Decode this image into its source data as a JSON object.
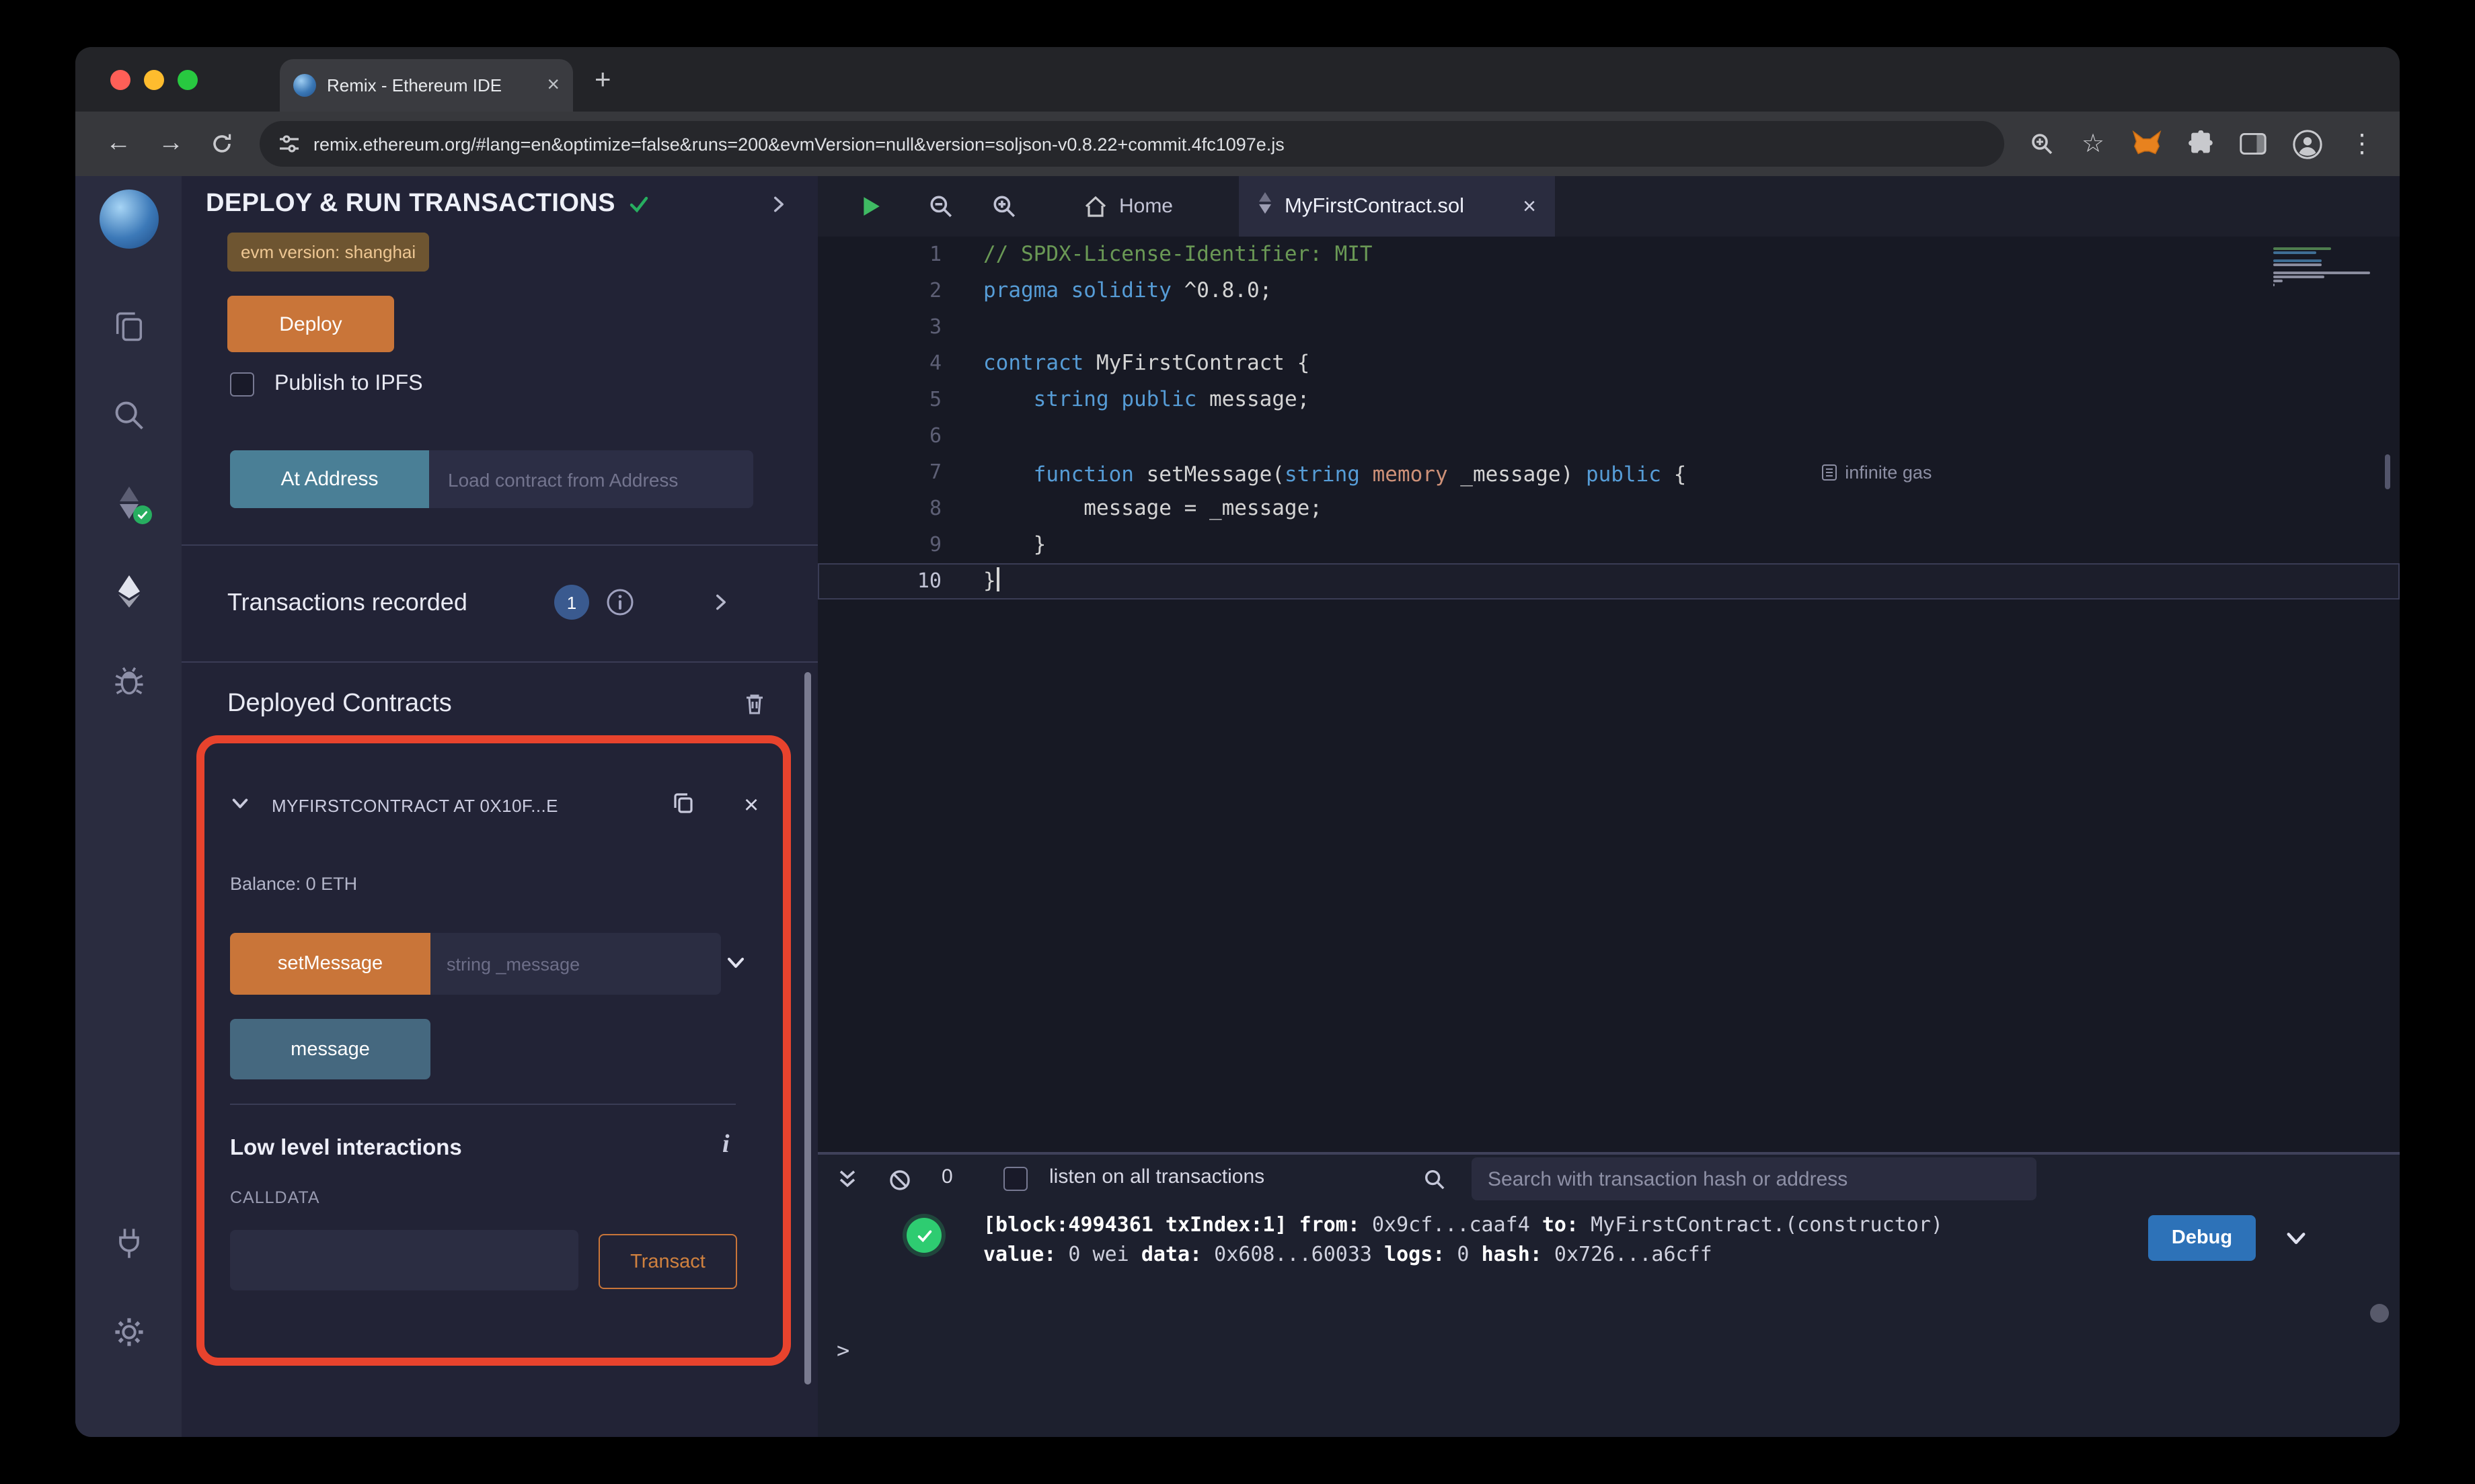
{
  "colors": {
    "accent_orange": "#c97539",
    "steel_blue": "#45687f",
    "at_address_teal": "#4a7f96",
    "debug_blue": "#2d72b8",
    "annotation_red": "#e8432d",
    "success_green": "#27ae60",
    "traffic_lights": [
      "#ff5f57",
      "#febc2e",
      "#28c840"
    ]
  },
  "glyphs": {
    "back": "←",
    "forward": "→",
    "star": "☆",
    "kebab": "⋮",
    "new_tab": "+",
    "tab_close": "×",
    "card_close": "×",
    "low_level_info": "i"
  },
  "browser": {
    "tab_title": "Remix - Ethereum IDE",
    "url": "remix.ethereum.org/#lang=en&optimize=false&runs=200&evmVersion=null&version=soljson-v0.8.22+commit.4fc1097e.js"
  },
  "deploy_panel": {
    "title": "DEPLOY & RUN TRANSACTIONS",
    "evm_badge": "evm version: shanghai",
    "deploy_label": "Deploy",
    "publish_label": "Publish to IPFS",
    "at_address_label": "At Address",
    "at_address_placeholder": "Load contract from Address",
    "transactions_recorded_label": "Transactions recorded",
    "transactions_count": "1",
    "deployed_contracts_label": "Deployed Contracts",
    "contract": {
      "title": "MYFIRSTCONTRACT AT 0X10F...E",
      "balance": "Balance: 0 ETH",
      "set_message_label": "setMessage",
      "set_message_placeholder": "string _message",
      "message_label": "message",
      "low_level_label": "Low level interactions",
      "calldata_label": "CALLDATA",
      "transact_label": "Transact"
    }
  },
  "editor": {
    "home_tab": "Home",
    "active_tab": "MyFirstContract.sol",
    "gas_hint": "infinite gas",
    "code_lines": [
      {
        "n": "1",
        "seg": [
          {
            "t": "// SPDX-License-Identifier: MIT",
            "c": "com"
          }
        ]
      },
      {
        "n": "2",
        "seg": [
          {
            "t": "pragma solidity",
            "c": "kw"
          },
          {
            "t": " ^0.8.0;",
            "c": "pl"
          }
        ]
      },
      {
        "n": "3",
        "seg": []
      },
      {
        "n": "4",
        "seg": [
          {
            "t": "contract",
            "c": "kw"
          },
          {
            "t": " MyFirstContract {",
            "c": "pl"
          }
        ]
      },
      {
        "n": "5",
        "seg": [
          {
            "t": "    ",
            "c": "pl"
          },
          {
            "t": "string",
            "c": "kw"
          },
          {
            "t": " ",
            "c": "pl"
          },
          {
            "t": "public",
            "c": "kw"
          },
          {
            "t": " message;",
            "c": "pl"
          }
        ]
      },
      {
        "n": "6",
        "seg": []
      },
      {
        "n": "7",
        "seg": [
          {
            "t": "    ",
            "c": "pl"
          },
          {
            "t": "function",
            "c": "kw"
          },
          {
            "t": " setMessage(",
            "c": "pl"
          },
          {
            "t": "string",
            "c": "kw"
          },
          {
            "t": " ",
            "c": "pl"
          },
          {
            "t": "memory",
            "c": "str"
          },
          {
            "t": " _message) ",
            "c": "pl"
          },
          {
            "t": "public",
            "c": "kw"
          },
          {
            "t": " {",
            "c": "pl"
          }
        ],
        "gas": true
      },
      {
        "n": "8",
        "seg": [
          {
            "t": "        message = _message;",
            "c": "pl"
          }
        ]
      },
      {
        "n": "9",
        "seg": [
          {
            "t": "    }",
            "c": "pl"
          }
        ]
      },
      {
        "n": "10",
        "seg": [
          {
            "t": "}",
            "c": "pl"
          }
        ],
        "current": true
      }
    ]
  },
  "terminal": {
    "pending_count": "0",
    "listen_label": "listen on all transactions",
    "search_placeholder": "Search with transaction hash or address",
    "debug_label": "Debug",
    "prompt": ">",
    "log_line1": [
      {
        "t": "[block:4994361 txIndex:1] ",
        "b": true
      },
      {
        "t": "from:",
        "b": true
      },
      {
        "t": " 0x9cf...caaf4 ",
        "b": false
      },
      {
        "t": "to:",
        "b": true
      },
      {
        "t": " MyFirstContract.(constructor)",
        "b": false
      }
    ],
    "log_line2": [
      {
        "t": "value:",
        "b": true
      },
      {
        "t": " 0 wei ",
        "b": false
      },
      {
        "t": "data:",
        "b": true
      },
      {
        "t": " 0x608...60033 ",
        "b": false
      },
      {
        "t": "logs:",
        "b": true
      },
      {
        "t": " 0 ",
        "b": false
      },
      {
        "t": "hash:",
        "b": true
      },
      {
        "t": " 0x726...a6cff",
        "b": false
      }
    ]
  }
}
